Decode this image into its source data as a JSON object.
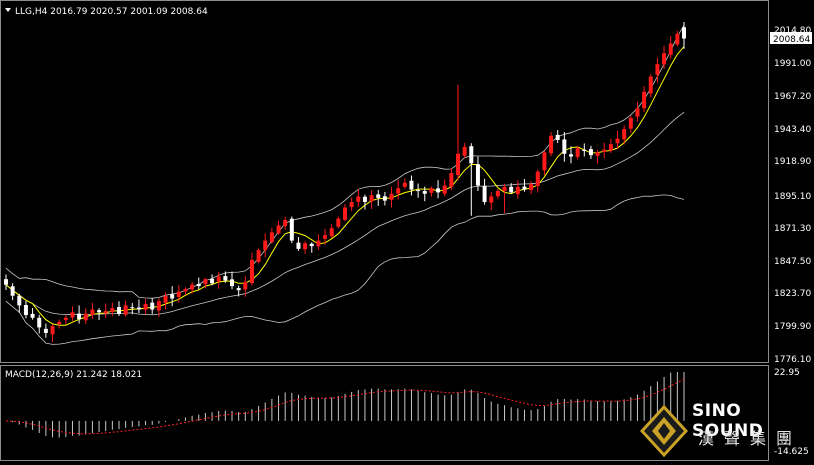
{
  "header": {
    "symbol_line": "LLG,H4  2016.79 2020.57 2001.09 2008.64",
    "dropdown_icon": "triangle-down-icon"
  },
  "price_axis": {
    "ticks": [
      "2014.80",
      "1991.00",
      "1967.20",
      "1943.40",
      "1918.90",
      "1895.10",
      "1871.30",
      "1847.50",
      "1823.70",
      "1799.90",
      "1776.10"
    ],
    "current_price_label": "2008.64"
  },
  "macd_panel": {
    "label": "MACD(12,26,9) 21.242 18.021",
    "ticks": [
      "22.95",
      "-14.625"
    ]
  },
  "logo": {
    "name": "SINO SOUND",
    "chinese": "漢聲集團",
    "icon": "diamond-logo-icon"
  },
  "colors": {
    "background": "#000000",
    "bull_candle": "#ff1a1a",
    "bear_candle": "#ffffff",
    "doji": "#30ff30",
    "fast_ma": "#ffff00",
    "bollinger": "#c8c8c8",
    "macd_histogram": "#c8c8c8",
    "macd_signal": "#ff2020"
  },
  "chart_data": {
    "type": "candlestick",
    "instrument": "LLG",
    "timeframe": "H4",
    "last_bar": {
      "open": 2016.79,
      "high": 2020.57,
      "low": 2001.09,
      "close": 2008.64
    },
    "y_range": [
      1776.1,
      2020.57
    ],
    "close_path": [
      1830,
      1822,
      1815,
      1808,
      1806,
      1799,
      1795,
      1800,
      1803,
      1806,
      1810,
      1805,
      1809,
      1812,
      1810,
      1811,
      1813,
      1809,
      1815,
      1813,
      1812,
      1816,
      1812,
      1818,
      1822,
      1820,
      1825,
      1827,
      1830,
      1829,
      1834,
      1831,
      1836,
      1833,
      1829,
      1826,
      1832,
      1848,
      1855,
      1862,
      1868,
      1873,
      1877,
      1862,
      1856,
      1860,
      1858,
      1862,
      1866,
      1871,
      1878,
      1886,
      1890,
      1894,
      1890,
      1895,
      1893,
      1891,
      1896,
      1900,
      1904,
      1899,
      1898,
      1896,
      1900,
      1897,
      1902,
      1911,
      1925,
      1930,
      1918,
      1902,
      1890,
      1894,
      1898,
      1901,
      1897,
      1901,
      1899,
      1903,
      1912,
      1926,
      1938,
      1935,
      1925,
      1923,
      1929,
      1927,
      1924,
      1926,
      1928,
      1932,
      1936,
      1943,
      1951,
      1958,
      1970,
      1981,
      1990,
      1998,
      2005,
      2012,
      2009
    ],
    "macd": {
      "value": 21.242,
      "signal": 18.021,
      "range": [
        -14.625,
        22.95
      ]
    }
  }
}
